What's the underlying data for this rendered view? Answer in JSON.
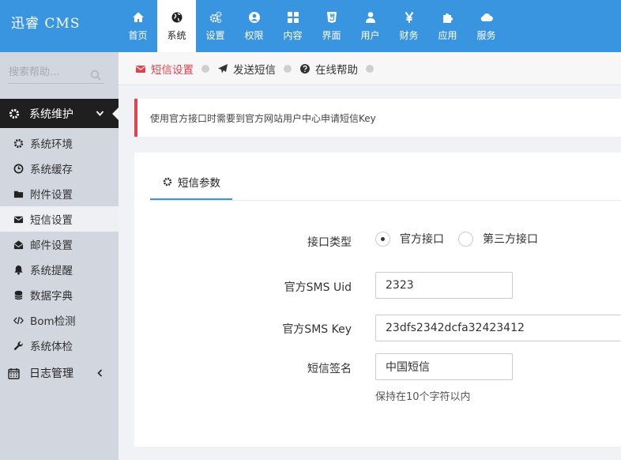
{
  "app": {
    "title": "迅睿 CMS"
  },
  "nav": [
    {
      "label": "首页",
      "icon": "home-icon"
    },
    {
      "label": "系统",
      "icon": "globe-icon"
    },
    {
      "label": "设置",
      "icon": "cogs-icon"
    },
    {
      "label": "权限",
      "icon": "user-circle-icon"
    },
    {
      "label": "内容",
      "icon": "grid-icon"
    },
    {
      "label": "界面",
      "icon": "html5-icon"
    },
    {
      "label": "用户",
      "icon": "user-icon"
    },
    {
      "label": "财务",
      "icon": "yen-icon"
    },
    {
      "label": "应用",
      "icon": "puzzle-icon"
    },
    {
      "label": "服务",
      "icon": "cloud-icon"
    }
  ],
  "sidebar": {
    "search_placeholder": "搜索帮助...",
    "group": "系统维护",
    "items": [
      {
        "label": "系统环境",
        "icon": "cog-icon"
      },
      {
        "label": "系统缓存",
        "icon": "clock-icon"
      },
      {
        "label": "附件设置",
        "icon": "folder-icon"
      },
      {
        "label": "短信设置",
        "icon": "envelope-icon"
      },
      {
        "label": "邮件设置",
        "icon": "envelope-open-icon"
      },
      {
        "label": "系统提醒",
        "icon": "bell-icon"
      },
      {
        "label": "数据字典",
        "icon": "database-icon"
      },
      {
        "label": "Bom检测",
        "icon": "code-icon"
      },
      {
        "label": "系统体检",
        "icon": "wrench-icon"
      }
    ],
    "log_group": "日志管理"
  },
  "crumbs": [
    {
      "label": "短信设置",
      "icon": "envelope-icon"
    },
    {
      "label": "发送短信",
      "icon": "paper-plane-icon"
    },
    {
      "label": "在线帮助",
      "icon": "question-circle-icon"
    }
  ],
  "alert": {
    "text": "使用官方接口时需要到官方网站用户中心申请短信Key"
  },
  "panel": {
    "tab_label": "短信参数",
    "fields": {
      "interface_type_label": "接口类型",
      "radio_official": "官方接口",
      "radio_third": "第三方接口",
      "uid_label": "官方SMS Uid",
      "uid_value": "2323",
      "key_label": "官方SMS Key",
      "key_value": "23dfs2342dcfa32423412",
      "sign_label": "短信签名",
      "sign_value": "中国短信",
      "sign_hint": "保持在10个字符以内"
    }
  },
  "colors": {
    "topbar": "#3a95e0",
    "accent_red": "#e0424f",
    "sidebar": "#d2d6df"
  }
}
